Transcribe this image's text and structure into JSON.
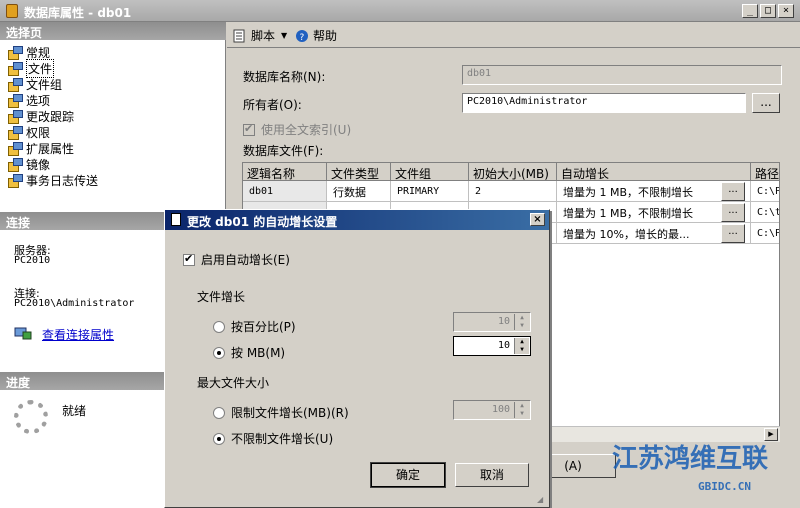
{
  "window": {
    "title": "数据库属性 - db01",
    "min_glyph": "_",
    "max_glyph": "□",
    "close_glyph": "×"
  },
  "sidebar": {
    "pages_header": "选择页",
    "items": [
      {
        "label": "常规"
      },
      {
        "label": "文件"
      },
      {
        "label": "文件组"
      },
      {
        "label": "选项"
      },
      {
        "label": "更改跟踪"
      },
      {
        "label": "权限"
      },
      {
        "label": "扩展属性"
      },
      {
        "label": "镜像"
      },
      {
        "label": "事务日志传送"
      }
    ],
    "connection_header": "连接",
    "server_label": "服务器:",
    "server_value": "PC2010",
    "connection_label": "连接:",
    "connection_value": "PC2010\\Administrator",
    "view_conn_link": "查看连接属性",
    "progress_header": "进度",
    "progress_status": "就绪"
  },
  "toolbar": {
    "script_label": "脚本",
    "help_label": "帮助"
  },
  "form": {
    "db_name_label": "数据库名称(N):",
    "db_name_value": "db01",
    "owner_label": "所有者(O):",
    "owner_value": "PC2010\\Administrator",
    "owner_browse": "...",
    "fulltext_label": "使用全文索引(U)",
    "db_files_label": "数据库文件(F):"
  },
  "grid": {
    "headers": [
      "逻辑名称",
      "文件类型",
      "文件组",
      "初始大小(MB)",
      "自动增长",
      "路径"
    ],
    "rows": [
      {
        "name": "db01",
        "type": "行数据",
        "group": "PRIMARY",
        "size": "2",
        "growth": "增量为 1 MB，不限制增长",
        "path": "C:\\Pr"
      },
      {
        "name": "",
        "type": "",
        "group": "",
        "size": "",
        "growth": "增量为 1 MB，不限制增长",
        "path": "C:\\te"
      },
      {
        "name": "",
        "type": "",
        "group": "",
        "size": "",
        "growth": "增量为 10%，增长的最...",
        "path": "C:\\Pr"
      }
    ],
    "ellipsis": "...",
    "add_button": "(A)"
  },
  "dialog": {
    "title": "更改 db01 的自动增长设置",
    "close_glyph": "×",
    "enable_label": "启用自动增长(E)",
    "file_growth_label": "文件增长",
    "by_percent_label": "按百分比(P)",
    "by_percent_value": "10",
    "by_mb_label": "按 MB(M)",
    "by_mb_value": "10",
    "max_size_label": "最大文件大小",
    "limit_label": "限制文件增长(MB)(R)",
    "limit_value": "100",
    "unlimited_label": "不限制文件增长(U)",
    "ok_label": "确定",
    "cancel_label": "取消"
  },
  "watermark": {
    "text": "江苏鸿维互联",
    "sub": "GBIDC.CN"
  },
  "colors": {
    "dialog_title_start": "#0a246a",
    "dialog_title_end": "#3a6ea5",
    "link": "#0000cc",
    "watermark": "#1a5fb4"
  }
}
